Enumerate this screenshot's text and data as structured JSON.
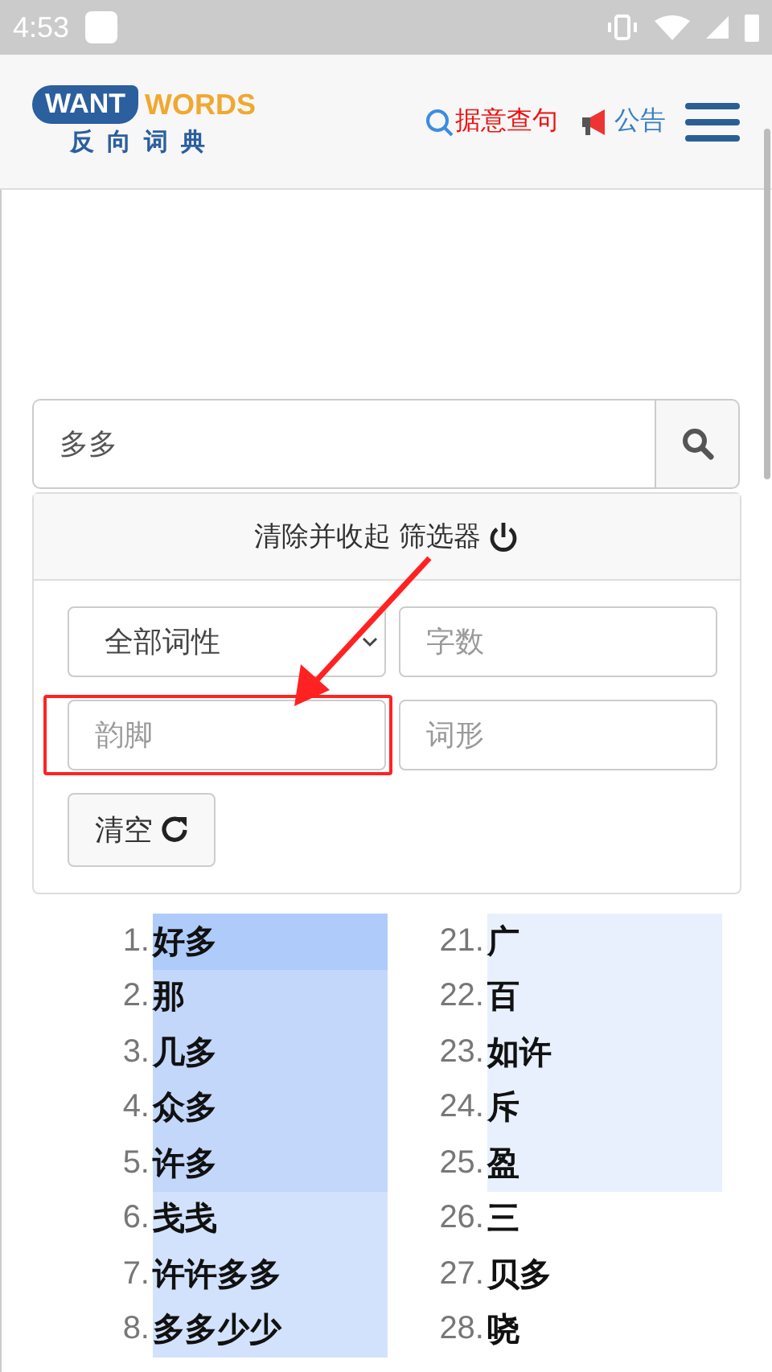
{
  "status_bar": {
    "time": "4:53"
  },
  "header": {
    "logo_left": "WANT",
    "logo_right": "WORDS",
    "logo_subtitle": "反向词典",
    "nav": [
      {
        "label": "据意查句",
        "kind": "search"
      },
      {
        "label": "公告",
        "kind": "announce"
      }
    ]
  },
  "search": {
    "value": "多多"
  },
  "filter": {
    "toggle_label": "清除并收起 筛选器",
    "pos_select": "全部词性",
    "fields": [
      {
        "placeholder": "字数",
        "highlighted": false
      },
      {
        "placeholder": "韵脚",
        "highlighted": true
      },
      {
        "placeholder": "词形",
        "highlighted": false
      }
    ],
    "clear_button": "清空"
  },
  "results": [
    {
      "items": [
        {
          "num": "1.",
          "word": "好多",
          "color": "#aecbfa"
        },
        {
          "num": "2.",
          "word": "那",
          "color": "#c3d7fb"
        },
        {
          "num": "3.",
          "word": "几多",
          "color": "#c3d7fb"
        },
        {
          "num": "4.",
          "word": "众多",
          "color": "#c3d7fb"
        },
        {
          "num": "5.",
          "word": "许多",
          "color": "#c3d7fb"
        },
        {
          "num": "6.",
          "word": "戋戋",
          "color": "#d2e2fc"
        },
        {
          "num": "7.",
          "word": "许许多多",
          "color": "#d2e2fc"
        },
        {
          "num": "8.",
          "word": "多多少少",
          "color": "#d2e2fc"
        }
      ]
    },
    {
      "items": [
        {
          "num": "21.",
          "word": "广",
          "color": "#e8f0fe"
        },
        {
          "num": "22.",
          "word": "百",
          "color": "#e8f0fe"
        },
        {
          "num": "23.",
          "word": "如许",
          "color": "#e8f0fe"
        },
        {
          "num": "24.",
          "word": "斥",
          "color": "#e8f0fe"
        },
        {
          "num": "25.",
          "word": "盈",
          "color": "#e8f0fe"
        },
        {
          "num": "26.",
          "word": "三",
          "color": "#ffffff"
        },
        {
          "num": "27.",
          "word": "贝多",
          "color": "#ffffff"
        },
        {
          "num": "28.",
          "word": "哓",
          "color": "#ffffff"
        }
      ]
    }
  ]
}
